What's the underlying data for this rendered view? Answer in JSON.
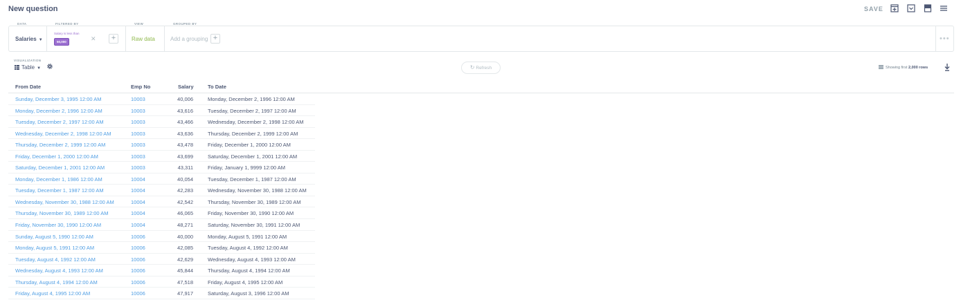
{
  "header": {
    "title": "New question",
    "save_label": "SAVE",
    "icons": [
      "add-to-dashboard-icon",
      "download-embed-icon",
      "bookmark-icon",
      "menu-icon"
    ]
  },
  "builder": {
    "data_label": "DATA",
    "data_source": "Salaries",
    "filter_label": "FILTERED BY",
    "filter_text": "Salary is less than",
    "filter_value": "50,000",
    "view_label": "VIEW",
    "view_value": "Raw data",
    "group_label": "GROUPED BY",
    "group_placeholder": "Add a grouping"
  },
  "viz": {
    "label": "VISUALIZATION",
    "type": "Table",
    "refresh_label": "Refresh",
    "rows_prefix": "Showing first ",
    "rows_count": "2,000 rows"
  },
  "colors": {
    "link": "#509ee3",
    "filter": "#9b6fd0",
    "raw_data": "#8fb94c"
  },
  "table": {
    "columns": [
      "From Date",
      "Emp No",
      "Salary",
      "To Date"
    ],
    "rows": [
      [
        "Sunday, December 3, 1995 12:00 AM",
        "10003",
        "40,006",
        "Monday, December 2, 1996 12:00 AM"
      ],
      [
        "Monday, December 2, 1996 12:00 AM",
        "10003",
        "43,616",
        "Tuesday, December 2, 1997 12:00 AM"
      ],
      [
        "Tuesday, December 2, 1997 12:00 AM",
        "10003",
        "43,466",
        "Wednesday, December 2, 1998 12:00 AM"
      ],
      [
        "Wednesday, December 2, 1998 12:00 AM",
        "10003",
        "43,636",
        "Thursday, December 2, 1999 12:00 AM"
      ],
      [
        "Thursday, December 2, 1999 12:00 AM",
        "10003",
        "43,478",
        "Friday, December 1, 2000 12:00 AM"
      ],
      [
        "Friday, December 1, 2000 12:00 AM",
        "10003",
        "43,699",
        "Saturday, December 1, 2001 12:00 AM"
      ],
      [
        "Saturday, December 1, 2001 12:00 AM",
        "10003",
        "43,311",
        "Friday, January 1, 9999 12:00 AM"
      ],
      [
        "Monday, December 1, 1986 12:00 AM",
        "10004",
        "40,054",
        "Tuesday, December 1, 1987 12:00 AM"
      ],
      [
        "Tuesday, December 1, 1987 12:00 AM",
        "10004",
        "42,283",
        "Wednesday, November 30, 1988 12:00 AM"
      ],
      [
        "Wednesday, November 30, 1988 12:00 AM",
        "10004",
        "42,542",
        "Thursday, November 30, 1989 12:00 AM"
      ],
      [
        "Thursday, November 30, 1989 12:00 AM",
        "10004",
        "46,065",
        "Friday, November 30, 1990 12:00 AM"
      ],
      [
        "Friday, November 30, 1990 12:00 AM",
        "10004",
        "48,271",
        "Saturday, November 30, 1991 12:00 AM"
      ],
      [
        "Sunday, August 5, 1990 12:00 AM",
        "10006",
        "40,000",
        "Monday, August 5, 1991 12:00 AM"
      ],
      [
        "Monday, August 5, 1991 12:00 AM",
        "10006",
        "42,085",
        "Tuesday, August 4, 1992 12:00 AM"
      ],
      [
        "Tuesday, August 4, 1992 12:00 AM",
        "10006",
        "42,629",
        "Wednesday, August 4, 1993 12:00 AM"
      ],
      [
        "Wednesday, August 4, 1993 12:00 AM",
        "10006",
        "45,844",
        "Thursday, August 4, 1994 12:00 AM"
      ],
      [
        "Thursday, August 4, 1994 12:00 AM",
        "10006",
        "47,518",
        "Friday, August 4, 1995 12:00 AM"
      ],
      [
        "Friday, August 4, 1995 12:00 AM",
        "10006",
        "47,917",
        "Saturday, August 3, 1996 12:00 AM"
      ]
    ]
  }
}
